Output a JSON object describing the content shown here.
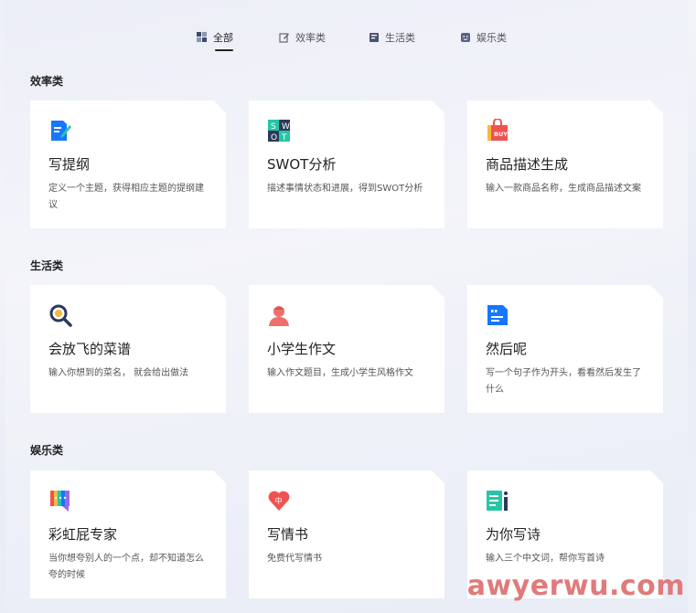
{
  "tabs": [
    {
      "label": "全部",
      "icon": "grid-icon"
    },
    {
      "label": "效率类",
      "icon": "edit-icon"
    },
    {
      "label": "生活类",
      "icon": "book-icon"
    },
    {
      "label": "娱乐类",
      "icon": "smile-icon"
    }
  ],
  "sections": [
    {
      "title": "效率类",
      "cards": [
        {
          "title": "写提纲",
          "desc": "定义一个主题，获得相应主题的提纲建议",
          "icon": "document-edit-icon"
        },
        {
          "title": "SWOT分析",
          "desc": "描述事情状态和进展，得到SWOT分析",
          "icon": "swot-icon"
        },
        {
          "title": "商品描述生成",
          "desc": "输入一款商品名称，生成商品描述文案",
          "icon": "shopping-bag-icon"
        }
      ]
    },
    {
      "title": "生活类",
      "cards": [
        {
          "title": "会放飞的菜谱",
          "desc": "输入你想到的菜名， 就会给出做法",
          "icon": "search-food-icon"
        },
        {
          "title": "小学生作文",
          "desc": "输入作文题目，生成小学生风格作文",
          "icon": "student-icon"
        },
        {
          "title": "然后呢",
          "desc": "写一个句子作为开头，看看然后发生了什么",
          "icon": "quote-card-icon"
        }
      ]
    },
    {
      "title": "娱乐类",
      "cards": [
        {
          "title": "彩虹屁专家",
          "desc": "当你想夸别人的一个点，却不知道怎么夸的时候",
          "icon": "rainbow-chat-icon"
        },
        {
          "title": "写情书",
          "desc": "免费代写情书",
          "icon": "heart-icon"
        },
        {
          "title": "为你写诗",
          "desc": "输入三个中文词，帮你写首诗",
          "icon": "poem-icon"
        }
      ]
    }
  ],
  "watermark": "awyerwu.com",
  "colors": {
    "accent": "#1677ff",
    "red": "#ef5350",
    "teal": "#26c6a5"
  }
}
